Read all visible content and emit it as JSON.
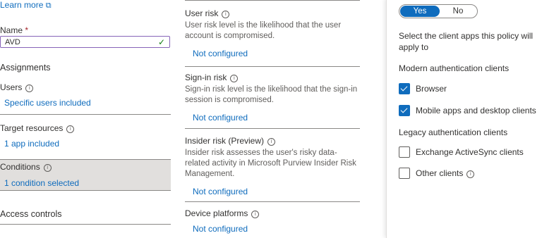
{
  "left": {
    "learn_more": "Learn more",
    "name_label": "Name",
    "required_mark": "*",
    "name_value": "AVD",
    "assignments": "Assignments",
    "users_label": "Users",
    "users_value": "Specific users included",
    "target_label": "Target resources",
    "target_value": "1 app included",
    "conditions_label": "Conditions",
    "conditions_value": "1 condition selected",
    "access_controls": "Access controls"
  },
  "middle": {
    "user_risk_title": "User risk",
    "user_risk_desc": "User risk level is the likelihood that the user account is compromised.",
    "user_risk_value": "Not configured",
    "signin_risk_title": "Sign-in risk",
    "signin_risk_desc": "Sign-in risk level is the likelihood that the sign-in session is compromised.",
    "signin_risk_value": "Not configured",
    "insider_risk_title": "Insider risk (Preview)",
    "insider_risk_desc": "Insider risk assesses the user's risky data-related activity in Microsoft Purview Insider Risk Management.",
    "insider_risk_value": "Not configured",
    "device_platforms_title": "Device platforms",
    "device_platforms_value": "Not configured"
  },
  "right": {
    "toggle_yes": "Yes",
    "toggle_no": "No",
    "select_prompt": "Select the client apps this policy will apply to",
    "modern_header": "Modern authentication clients",
    "browser": "Browser",
    "mobile": "Mobile apps and desktop clients",
    "legacy_header": "Legacy authentication clients",
    "exchange": "Exchange ActiveSync clients",
    "other": "Other clients"
  },
  "colors": {
    "accent": "#0f6cbd",
    "selected_bg": "#e1dfdd",
    "panel_border": "#e1dfdd"
  }
}
